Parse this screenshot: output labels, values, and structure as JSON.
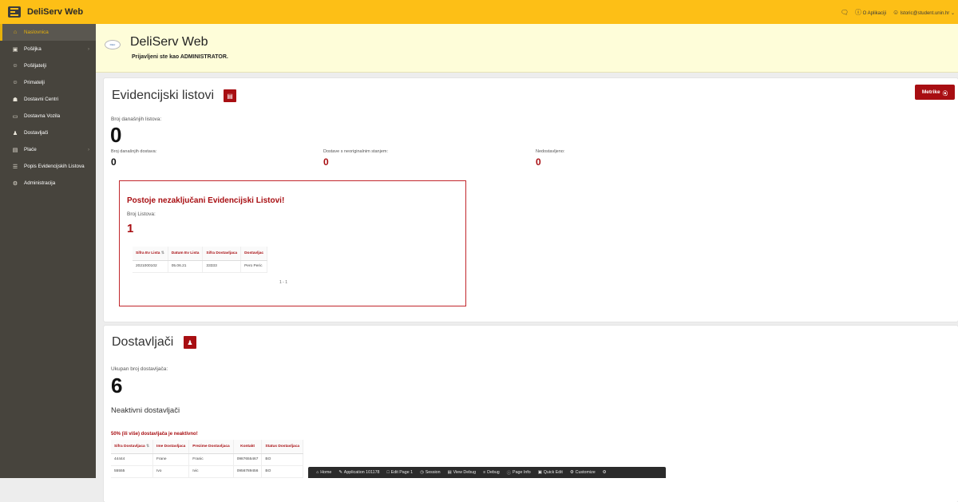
{
  "header": {
    "app_title": "DeliServ Web",
    "about_label": "O Aplikaciji",
    "user_label": "lstoric@student.unin.hr"
  },
  "sidebar": {
    "items": [
      {
        "label": "Naslovnica",
        "icon": "home-icon",
        "active": true,
        "has_children": false
      },
      {
        "label": "Pošiljka",
        "icon": "package-icon",
        "active": false,
        "has_children": true
      },
      {
        "label": "Pošiljatelji",
        "icon": "user-icon",
        "active": false,
        "has_children": false
      },
      {
        "label": "Primatelji",
        "icon": "user-icon",
        "active": false,
        "has_children": false
      },
      {
        "label": "Dostavni Centri",
        "icon": "building-icon",
        "active": false,
        "has_children": false
      },
      {
        "label": "Dostavna Vozila",
        "icon": "vehicle-icon",
        "active": false,
        "has_children": false
      },
      {
        "label": "Dostavljači",
        "icon": "users-icon",
        "active": false,
        "has_children": false
      },
      {
        "label": "Plaće",
        "icon": "money-icon",
        "active": false,
        "has_children": true
      },
      {
        "label": "Popis Evidencijskih Listova",
        "icon": "list-icon",
        "active": false,
        "has_children": false
      },
      {
        "label": "Administracija",
        "icon": "admin-icon",
        "active": false,
        "has_children": false
      }
    ]
  },
  "hero": {
    "title": "DeliServ Web",
    "subtitle": "Prijavljeni ste kao ADMINISTRATOR."
  },
  "evidencijski": {
    "title": "Evidencijski listovi",
    "metrike_label": "Metrike",
    "today_lists_label": "Broj današnjih listova:",
    "today_lists_value": "0",
    "today_deliveries_label": "Broj današnjih dostava:",
    "today_deliveries_value": "0",
    "unoriginal_label": "Dostave s neoriginalnim stanjem:",
    "unoriginal_value": "0",
    "undelivered_label": "Nedostavljeno:",
    "undelivered_value": "0",
    "alert": {
      "title": "Postoje nezaključani Evidencijski Listovi!",
      "count_label": "Broj Listova:",
      "count_value": "1",
      "columns": [
        "Sifra Ev Lista",
        "Datum Ev Lista",
        "Sifra Dostavljaca",
        "Dostavljac"
      ],
      "rows": [
        [
          "2021000102",
          "05.06.21",
          "33333",
          "Pero Peric"
        ]
      ],
      "pager": "1 - 1"
    }
  },
  "dostavljaci": {
    "title": "Dostavljači",
    "total_label": "Ukupan broj dostavljača:",
    "total_value": "6",
    "inactive_heading": "Neaktivni dostavljači",
    "warning": "50% (ili više) dostavljača je neaktivno!",
    "columns": [
      "Sifra Dostavljaca",
      "Ime Dostavljaca",
      "Prezime Dostavljaca",
      "Kontakt",
      "Status Dostavljaca"
    ],
    "rows": [
      [
        "44444",
        "Frane",
        "Franic",
        "0987655467",
        "BO"
      ],
      [
        "55555",
        "Ivo",
        "Ivic",
        "0956789456",
        "BO"
      ]
    ]
  },
  "devbar": {
    "items": [
      "Home",
      "Application 101178",
      "Edit Page 1",
      "Session",
      "View Debug",
      "Debug",
      "Page Info",
      "Quick Edit",
      "Customize"
    ]
  }
}
